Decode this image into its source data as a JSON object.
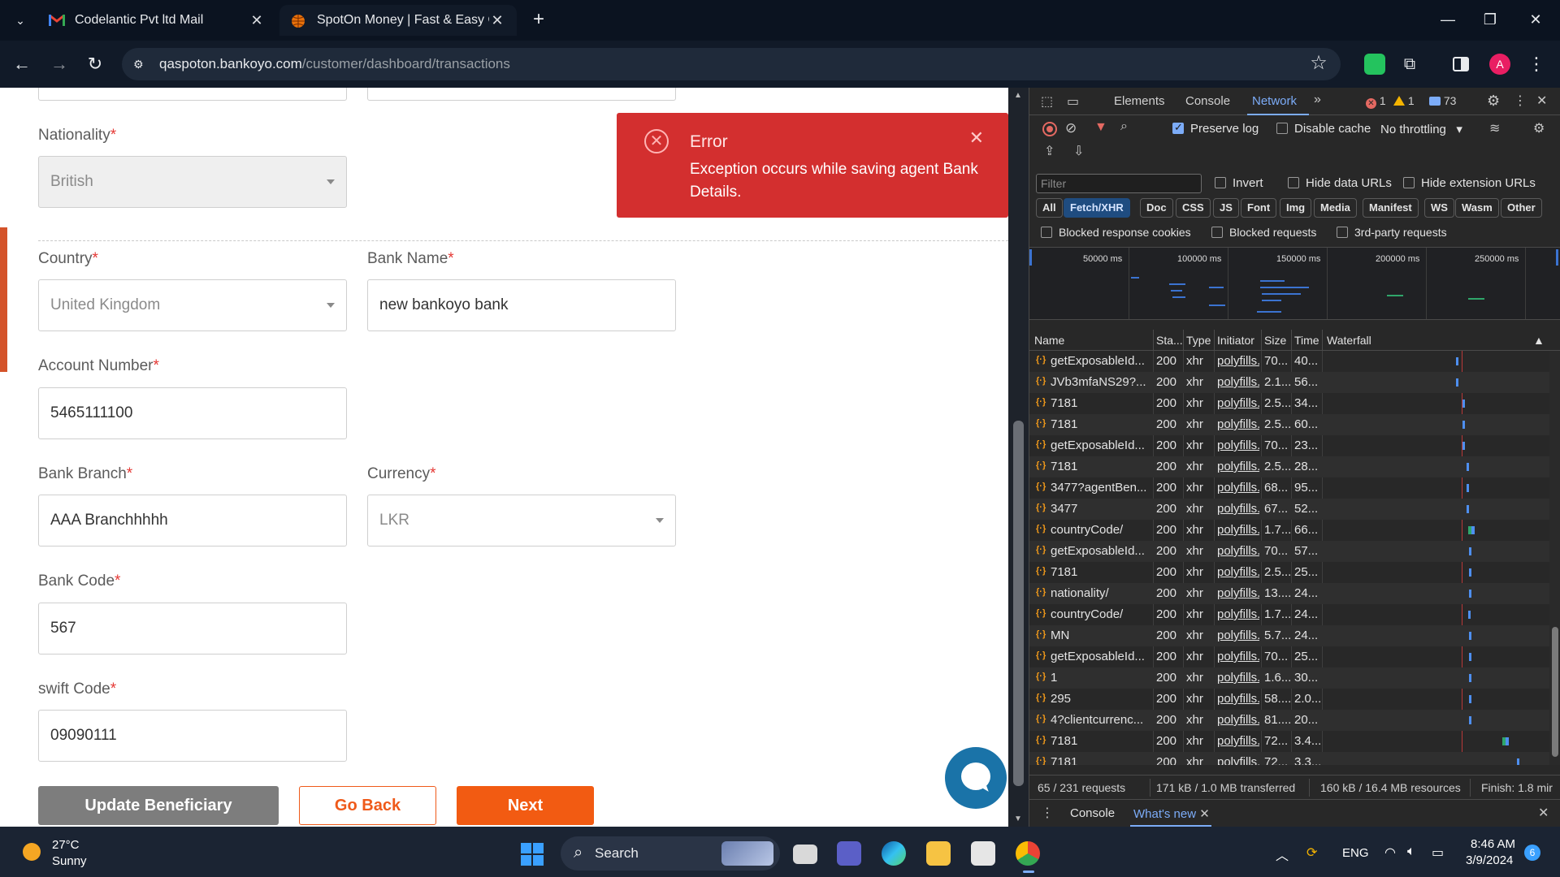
{
  "browser": {
    "tabs": [
      {
        "title": "Codelantic Pvt ltd Mail",
        "favicon": "gmail-icon"
      },
      {
        "title": "SpotOn Money | Fast & Easy Or",
        "favicon": "globe-icon"
      }
    ],
    "url_domain": "qaspoton.bankoyo.com",
    "url_path": "/customer/dashboard/transactions",
    "profile_initial": "A"
  },
  "form": {
    "nationality": {
      "label": "Nationality",
      "required": "*",
      "value": "British"
    },
    "country": {
      "label": "Country",
      "required": "*",
      "value": "United Kingdom"
    },
    "bank_name": {
      "label": "Bank Name",
      "required": "*",
      "value": "new bankoyo bank"
    },
    "account_number": {
      "label": "Account Number",
      "required": "*",
      "value": "5465111100"
    },
    "bank_branch": {
      "label": "Bank Branch",
      "required": "*",
      "value": "AAA Branchhhhh"
    },
    "currency": {
      "label": "Currency",
      "required": "*",
      "value": "LKR"
    },
    "bank_code": {
      "label": "Bank Code",
      "required": "*",
      "value": "567"
    },
    "swift_code": {
      "label": "swift Code",
      "required": "*",
      "value": "09090111"
    },
    "buttons": {
      "update": "Update Beneficiary",
      "back": "Go Back",
      "next": "Next"
    }
  },
  "toast": {
    "title": "Error",
    "message": "Exception occurs while saving agent Bank Details.",
    "color": "#d32f2f"
  },
  "devtools": {
    "tabs": {
      "elements": "Elements",
      "console": "Console",
      "network": "Network"
    },
    "counts": {
      "errors": "1",
      "warnings": "1",
      "messages": "73"
    },
    "preserve_log": "Preserve log",
    "disable_cache": "Disable cache",
    "throttling": "No throttling",
    "filter_placeholder": "Filter",
    "invert": "Invert",
    "hide_data_urls": "Hide data URLs",
    "hide_extension_urls": "Hide extension URLs",
    "type_filters": [
      "All",
      "Fetch/XHR",
      "Doc",
      "CSS",
      "JS",
      "Font",
      "Img",
      "Media",
      "Manifest",
      "WS",
      "Wasm",
      "Other"
    ],
    "blocked_response_cookies": "Blocked response cookies",
    "blocked_requests": "Blocked requests",
    "third_party": "3rd-party requests",
    "overview_ticks": [
      "50000 ms",
      "100000 ms",
      "150000 ms",
      "200000 ms",
      "250000 ms"
    ],
    "columns": {
      "name": "Name",
      "status": "Sta...",
      "type": "Type",
      "initiator": "Initiator",
      "size": "Size",
      "time": "Time",
      "waterfall": "Waterfall"
    },
    "requests": [
      {
        "name": "getExposableId...",
        "status": "200",
        "type": "xhr",
        "initiator": "polyfills....",
        "size": "70...",
        "time": "40..."
      },
      {
        "name": "JVb3mfaNS29?...",
        "status": "200",
        "type": "xhr",
        "initiator": "polyfills....",
        "size": "2.1...",
        "time": "56..."
      },
      {
        "name": "7181",
        "status": "200",
        "type": "xhr",
        "initiator": "polyfills....",
        "size": "2.5...",
        "time": "34..."
      },
      {
        "name": "7181",
        "status": "200",
        "type": "xhr",
        "initiator": "polyfills....",
        "size": "2.5...",
        "time": "60..."
      },
      {
        "name": "getExposableId...",
        "status": "200",
        "type": "xhr",
        "initiator": "polyfills....",
        "size": "70...",
        "time": "23..."
      },
      {
        "name": "7181",
        "status": "200",
        "type": "xhr",
        "initiator": "polyfills....",
        "size": "2.5...",
        "time": "28..."
      },
      {
        "name": "3477?agentBen...",
        "status": "200",
        "type": "xhr",
        "initiator": "polyfills....",
        "size": "68...",
        "time": "95..."
      },
      {
        "name": "3477",
        "status": "200",
        "type": "xhr",
        "initiator": "polyfills....",
        "size": "67...",
        "time": "52..."
      },
      {
        "name": "countryCode/",
        "status": "200",
        "type": "xhr",
        "initiator": "polyfills....",
        "size": "1.7...",
        "time": "66..."
      },
      {
        "name": "getExposableId...",
        "status": "200",
        "type": "xhr",
        "initiator": "polyfills....",
        "size": "70...",
        "time": "57..."
      },
      {
        "name": "7181",
        "status": "200",
        "type": "xhr",
        "initiator": "polyfills....",
        "size": "2.5...",
        "time": "25..."
      },
      {
        "name": "nationality/",
        "status": "200",
        "type": "xhr",
        "initiator": "polyfills....",
        "size": "13....",
        "time": "24..."
      },
      {
        "name": "countryCode/",
        "status": "200",
        "type": "xhr",
        "initiator": "polyfills....",
        "size": "1.7...",
        "time": "24..."
      },
      {
        "name": "MN",
        "status": "200",
        "type": "xhr",
        "initiator": "polyfills....",
        "size": "5.7...",
        "time": "24..."
      },
      {
        "name": "getExposableId...",
        "status": "200",
        "type": "xhr",
        "initiator": "polyfills....",
        "size": "70...",
        "time": "25..."
      },
      {
        "name": "1",
        "status": "200",
        "type": "xhr",
        "initiator": "polyfills....",
        "size": "1.6...",
        "time": "30..."
      },
      {
        "name": "295",
        "status": "200",
        "type": "xhr",
        "initiator": "polyfills....",
        "size": "58....",
        "time": "2.0..."
      },
      {
        "name": "4?clientcurrenc...",
        "status": "200",
        "type": "xhr",
        "initiator": "polyfills....",
        "size": "81....",
        "time": "20..."
      },
      {
        "name": "7181",
        "status": "200",
        "type": "xhr",
        "initiator": "polyfills....",
        "size": "72...",
        "time": "3.4..."
      },
      {
        "name": "7181",
        "status": "200",
        "type": "xhr",
        "initiator": "polyfills....",
        "size": "72...",
        "time": "3.3..."
      }
    ],
    "status": {
      "requests": "65 / 231 requests",
      "transferred": "171 kB / 1.0 MB transferred",
      "resources": "160 kB / 16.4 MB resources",
      "finish": "Finish: 1.8 mir"
    },
    "drawer": {
      "console": "Console",
      "whats_new": "What's new"
    }
  },
  "taskbar": {
    "temperature": "27°C",
    "condition": "Sunny",
    "search": "Search",
    "language": "ENG",
    "time": "8:46 AM",
    "date": "3/9/2024",
    "notifications": "6"
  }
}
